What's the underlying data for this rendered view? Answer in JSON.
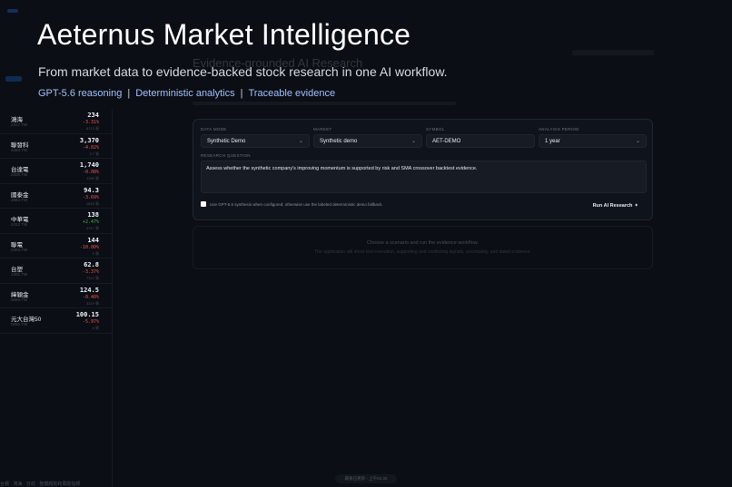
{
  "hero": {
    "title": "Aeternus Market Intelligence",
    "subtitle": "From market data to evidence-backed stock research in one AI workflow.",
    "tags": [
      "GPT-5.6 reasoning",
      "Deterministic analytics",
      "Traceable evidence"
    ],
    "separator": "|"
  },
  "ghost": {
    "heading": "Evidence-grounded AI Research"
  },
  "sidebar": {
    "stocks": [
      {
        "name": "鴻海",
        "sub": "2317.TW",
        "price": "234",
        "change": "-3.31%",
        "volume": "8713 張",
        "dir": "down"
      },
      {
        "name": "聯發科",
        "sub": "2454.TW",
        "price": "3,370",
        "change": "-4.02%",
        "volume": "3.7 張",
        "dir": "down"
      },
      {
        "name": "台達電",
        "sub": "2308.TW",
        "price": "1,740",
        "change": "-0.08%",
        "volume": "1185 張",
        "dir": "down"
      },
      {
        "name": "國泰金",
        "sub": "2882.TW",
        "price": "94.3",
        "change": "-3.69%",
        "volume": "2818 張",
        "dir": "down"
      },
      {
        "name": "中華電",
        "sub": "2412.TW",
        "price": "138",
        "change": "+2.47%",
        "volume": "3747 張",
        "dir": "up"
      },
      {
        "name": "聯電",
        "sub": "2303.TW",
        "price": "144",
        "change": "-10.00%",
        "volume": "3 張",
        "dir": "down"
      },
      {
        "name": "台塑",
        "sub": "1301.TW",
        "price": "62.8",
        "change": "-3.37%",
        "volume": "7312 張",
        "dir": "down"
      },
      {
        "name": "緯穎金",
        "sub": "6669.TW",
        "price": "124.5",
        "change": "-0.40%",
        "volume": "3219 張",
        "dir": "down"
      },
      {
        "name": "元大台灣50",
        "sub": "0050.TW",
        "price": "100.15",
        "change": "-5.97%",
        "volume": "4 張",
        "dir": "down"
      }
    ]
  },
  "form": {
    "data_mode_label": "DATA MODE",
    "data_mode_value": "Synthetic Demo",
    "market_label": "MARKET",
    "market_value": "Synthetic demo",
    "symbol_label": "SYMBOL",
    "symbol_value": "AET-DEMO",
    "period_label": "ANALYSIS PERIOD",
    "period_value": "1 year",
    "question_label": "RESEARCH QUESTION",
    "question_value": "Assess whether the synthetic company's improving momentum is supported by risk and SMA crossover backtest evidence.",
    "checkbox_text": "Use GPT-5.6 synthesis when configured; otherwise use the labeled deterministic demo fallback.",
    "run_label": "Run AI Research",
    "run_icon": "✦"
  },
  "results": {
    "line1": "Choose a scenario and run the evidence workflow.",
    "line2": "The application will show tool execution, supporting and conflicting signals, uncertainty, and dated evidence."
  },
  "footer": {
    "pill": "最後已更新 · 上午01:35",
    "status": "台積 · 鴻海 · 日前 · 整體趨勢和風險指標"
  },
  "colors": {
    "background": "#0b0e14",
    "accent": "#1f6feb",
    "tag": "#9ec1ff",
    "up": "#3fb950",
    "down": "#f85149"
  }
}
